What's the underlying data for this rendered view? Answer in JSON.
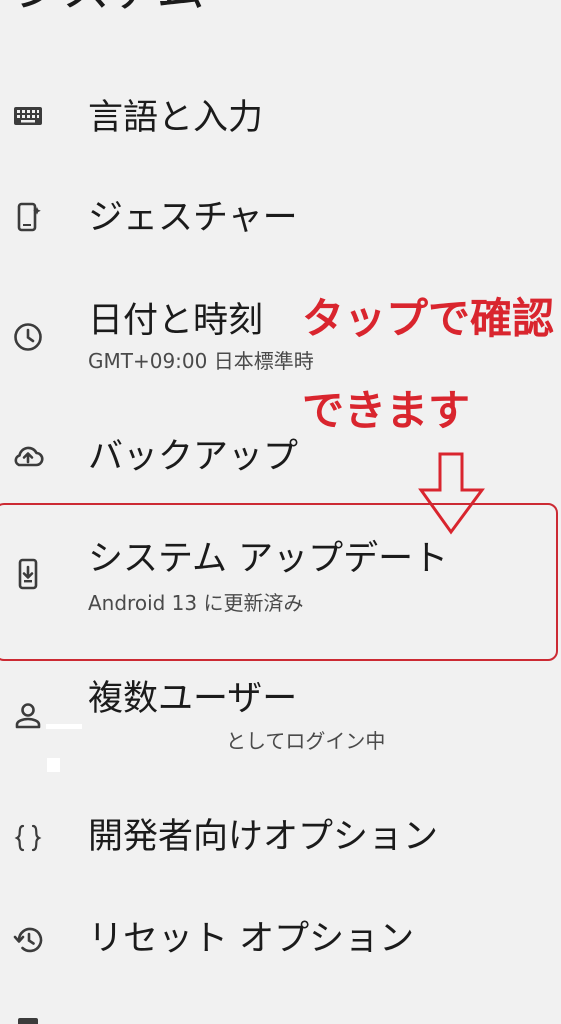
{
  "page": {
    "title": "システム"
  },
  "items": [
    {
      "title": "言語と入力",
      "summary": "",
      "icon": "keyboard-icon"
    },
    {
      "title": "ジェスチャー",
      "summary": "",
      "icon": "phone-gesture-icon"
    },
    {
      "title": "日付と時刻",
      "summary": "GMT+09:00 日本標準時",
      "icon": "clock-icon"
    },
    {
      "title": "バックアップ",
      "summary": "",
      "icon": "cloud-upload-icon"
    },
    {
      "title": "システム アップデート",
      "summary": "Android 13 に更新済み",
      "icon": "system-update-icon"
    },
    {
      "title": "複数ユーザー",
      "summary": "としてログイン中",
      "icon": "person-icon"
    },
    {
      "title": "開発者向けオプション",
      "summary": "",
      "icon": "braces-icon"
    },
    {
      "title": "リセット オプション",
      "summary": "",
      "icon": "history-icon"
    }
  ],
  "annotation": {
    "line1": "タップで確認",
    "line2": "できます",
    "color": "#d9252e"
  }
}
